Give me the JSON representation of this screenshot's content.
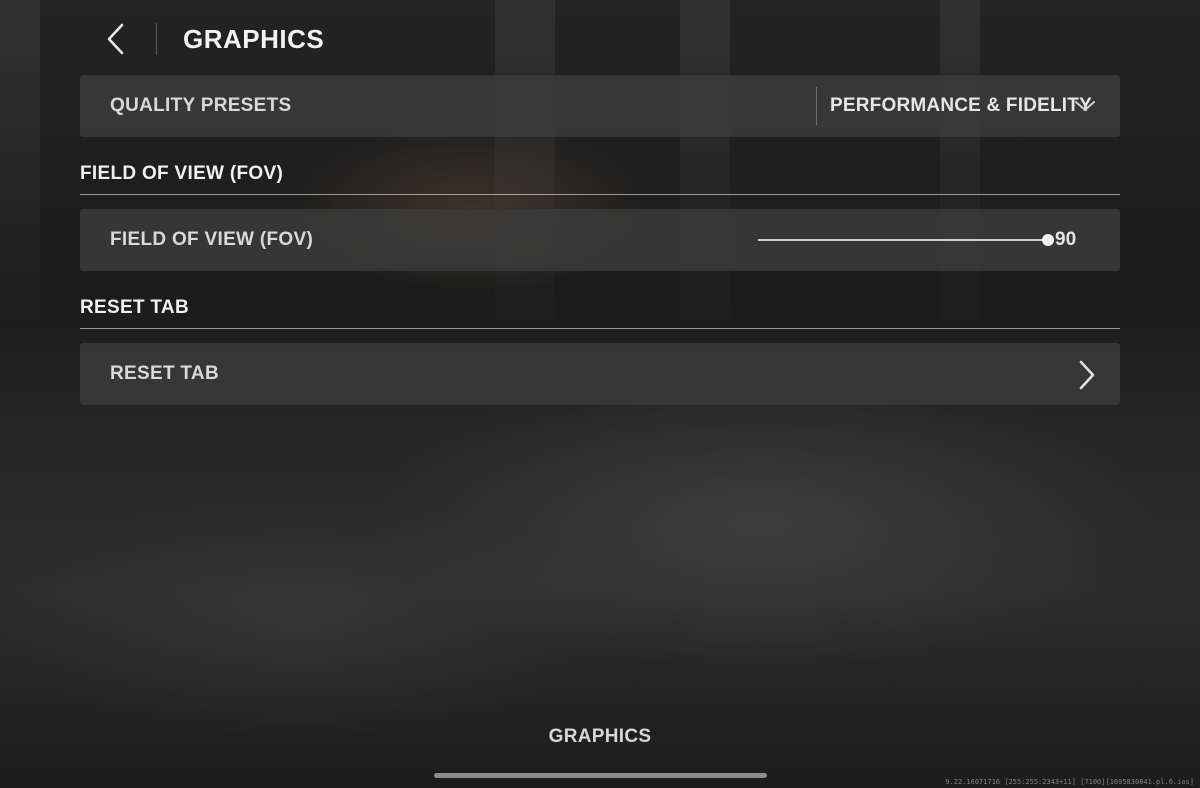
{
  "header": {
    "title": "GRAPHICS"
  },
  "quality_presets": {
    "label": "QUALITY PRESETS",
    "value": "PERFORMANCE & FIDELITY"
  },
  "fov_section": {
    "title": "FIELD OF VIEW (FOV)",
    "row_label": "FIELD OF VIEW (FOV)",
    "slider_fill_fraction": 1.0,
    "value": "90"
  },
  "reset_section": {
    "title": "RESET TAB",
    "row_label": "RESET TAB"
  },
  "footer": {
    "tab_label": "GRAPHICS",
    "build_string": "9.22.16071716 [255:255:2343+11] [7100][1695830841.pl.6.ios]"
  },
  "icons": {
    "back": "chevron-left-icon",
    "dropdown": "chevron-down-icon",
    "reset": "chevron-right-icon"
  }
}
